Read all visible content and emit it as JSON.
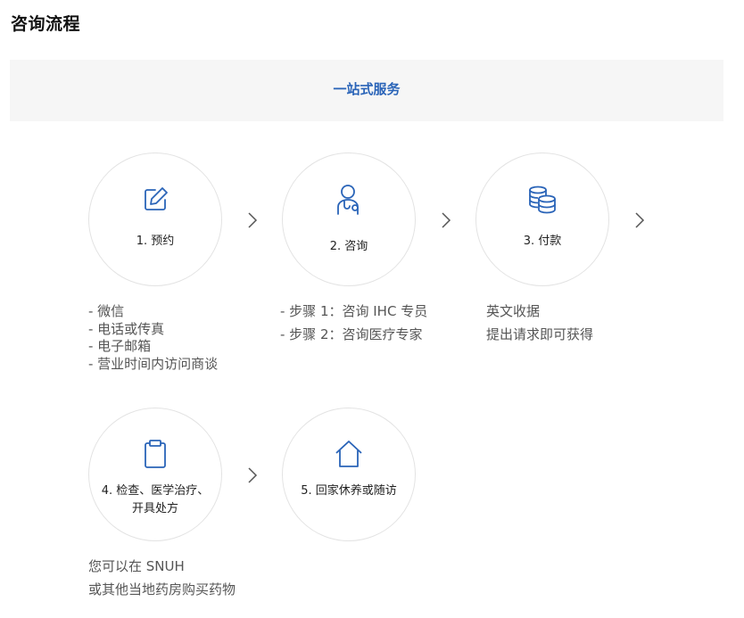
{
  "page_title": "咨询流程",
  "banner": {
    "label": "一站式服务"
  },
  "steps": [
    {
      "label": "1. 预约",
      "icon": "edit-icon",
      "desc": [
        "- 微信",
        "- 电话或传真",
        "- 电子邮箱",
        "- 营业时间内访问商谈"
      ]
    },
    {
      "label": "2. 咨询",
      "icon": "doctor-icon",
      "desc": [
        "- 步骤 1：咨询 IHC 专员",
        "- 步骤 2：咨询医疗专家"
      ]
    },
    {
      "label": "3. 付款",
      "icon": "coins-icon",
      "desc": [
        "英文收据",
        "提出请求即可获得"
      ]
    },
    {
      "label_lines": [
        "4. 检查、医学治疗、",
        "开具处方"
      ],
      "icon": "clipboard-icon",
      "desc": [
        "您可以在 SNUH",
        "或其他当地药房购买药物"
      ]
    },
    {
      "label": "5. 回家休养或随访",
      "icon": "home-icon"
    }
  ],
  "colors": {
    "accent": "#2a64b8",
    "border": "#e3e3e3",
    "banner_bg": "#f6f6f6"
  }
}
